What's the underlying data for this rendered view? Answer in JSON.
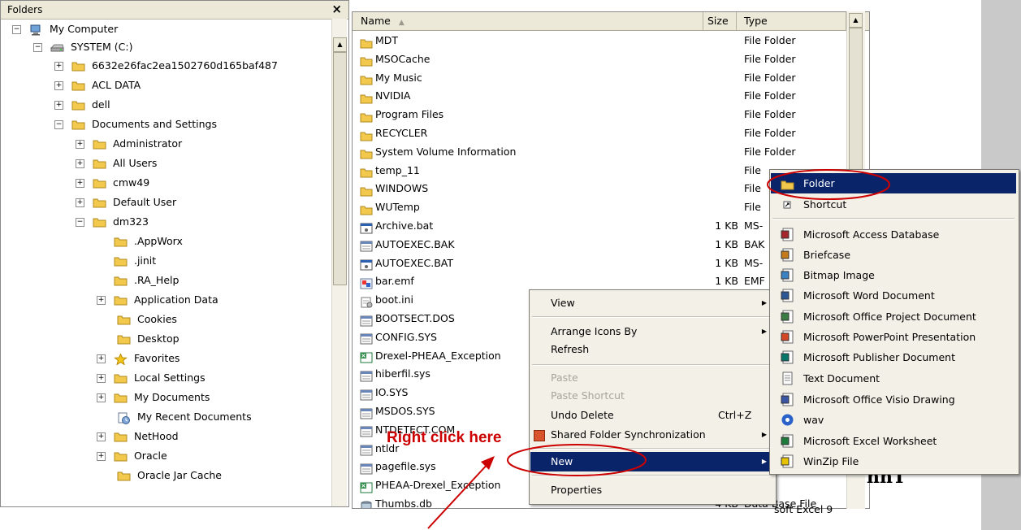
{
  "colors": {
    "accent": "#cc0000",
    "highlight": "#0a246a",
    "folder": "#f2c94c"
  },
  "folders_pane": {
    "title": "Folders",
    "close_label": "×",
    "tree": [
      {
        "label": "My Computer",
        "pm": "minus",
        "icon": "computer-icon"
      },
      {
        "label": "SYSTEM (C:)",
        "pm": "minus",
        "icon": "drive-icon"
      },
      {
        "label": "6632e26fac2ea1502760d165baf487",
        "pm": "plus",
        "icon": "folder-icon"
      },
      {
        "label": "ACL DATA",
        "pm": "plus",
        "icon": "folder-icon"
      },
      {
        "label": "dell",
        "pm": "plus",
        "icon": "folder-icon"
      },
      {
        "label": "Documents and Settings",
        "pm": "minus",
        "icon": "folder-icon"
      },
      {
        "label": "Administrator",
        "pm": "plus",
        "icon": "folder-icon"
      },
      {
        "label": "All Users",
        "pm": "plus",
        "icon": "folder-icon"
      },
      {
        "label": "cmw49",
        "pm": "plus",
        "icon": "folder-icon"
      },
      {
        "label": "Default User",
        "pm": "plus",
        "icon": "folder-icon"
      },
      {
        "label": "dm323",
        "pm": "minus",
        "icon": "folder-icon"
      },
      {
        "label": ".AppWorx",
        "pm": "none",
        "icon": "folder-icon"
      },
      {
        "label": ".jinit",
        "pm": "none",
        "icon": "folder-icon"
      },
      {
        "label": ".RA_Help",
        "pm": "none",
        "icon": "folder-icon"
      },
      {
        "label": "Application Data",
        "pm": "plus",
        "icon": "folder-icon"
      },
      {
        "label": "Cookies",
        "pm": "none",
        "icon": "folder-icon"
      },
      {
        "label": "Desktop",
        "pm": "none",
        "icon": "folder-icon"
      },
      {
        "label": "Favorites",
        "pm": "plus",
        "icon": "star-icon"
      },
      {
        "label": "Local Settings",
        "pm": "plus",
        "icon": "folder-icon"
      },
      {
        "label": "My Documents",
        "pm": "plus",
        "icon": "folder-icon"
      },
      {
        "label": "My Recent Documents",
        "pm": "none",
        "icon": "recent-docs-icon"
      },
      {
        "label": "NetHood",
        "pm": "plus",
        "icon": "folder-icon"
      },
      {
        "label": "Oracle",
        "pm": "plus",
        "icon": "folder-icon"
      },
      {
        "label": "Oracle Jar Cache",
        "pm": "none",
        "icon": "folder-icon"
      }
    ]
  },
  "files_pane": {
    "columns": {
      "name": "Name",
      "size": "Size",
      "type": "Type"
    },
    "rows": [
      {
        "name": "MDT",
        "size": "",
        "type": "File Folder",
        "icon": "folder-icon"
      },
      {
        "name": "MSOCache",
        "size": "",
        "type": "File Folder",
        "icon": "folder-icon"
      },
      {
        "name": "My Music",
        "size": "",
        "type": "File Folder",
        "icon": "folder-icon"
      },
      {
        "name": "NVIDIA",
        "size": "",
        "type": "File Folder",
        "icon": "folder-icon"
      },
      {
        "name": "Program Files",
        "size": "",
        "type": "File Folder",
        "icon": "folder-icon"
      },
      {
        "name": "RECYCLER",
        "size": "",
        "type": "File Folder",
        "icon": "folder-icon"
      },
      {
        "name": "System Volume Information",
        "size": "",
        "type": "File Folder",
        "icon": "folder-icon"
      },
      {
        "name": "temp_11",
        "size": "",
        "type": "File",
        "icon": "folder-icon"
      },
      {
        "name": "WINDOWS",
        "size": "",
        "type": "File",
        "icon": "folder-icon"
      },
      {
        "name": "WUTemp",
        "size": "",
        "type": "File",
        "icon": "folder-icon"
      },
      {
        "name": "Archive.bat",
        "size": "1 KB",
        "type": "MS-",
        "icon": "bat-icon"
      },
      {
        "name": "AUTOEXEC.BAK",
        "size": "1 KB",
        "type": "BAK",
        "icon": "file-icon"
      },
      {
        "name": "AUTOEXEC.BAT",
        "size": "1 KB",
        "type": "MS-",
        "icon": "bat-icon"
      },
      {
        "name": "bar.emf",
        "size": "1 KB",
        "type": "EMF",
        "icon": "image-icon"
      },
      {
        "name": "boot.ini",
        "size": "",
        "type": "",
        "icon": "ini-icon"
      },
      {
        "name": "BOOTSECT.DOS",
        "size": "",
        "type": "",
        "icon": "file-icon"
      },
      {
        "name": "CONFIG.SYS",
        "size": "",
        "type": "",
        "icon": "file-icon"
      },
      {
        "name": "Drexel-PHEAA_Exception",
        "size": "",
        "type": "",
        "icon": "excel-icon"
      },
      {
        "name": "hiberfil.sys",
        "size": "",
        "type": "",
        "icon": "file-icon"
      },
      {
        "name": "IO.SYS",
        "size": "",
        "type": "",
        "icon": "file-icon"
      },
      {
        "name": "MSDOS.SYS",
        "size": "",
        "type": "",
        "icon": "file-icon"
      },
      {
        "name": "NTDETECT.COM",
        "size": "",
        "type": "",
        "icon": "file-icon"
      },
      {
        "name": "ntldr",
        "size": "",
        "type": "",
        "icon": "file-icon"
      },
      {
        "name": "pagefile.sys",
        "size": "",
        "type": "",
        "icon": "file-icon"
      },
      {
        "name": "PHEAA-Drexel_Exception",
        "size": "",
        "type": "",
        "icon": "excel-icon"
      },
      {
        "name": "Thumbs.db",
        "size": "4 KB",
        "type": "Data Base File",
        "icon": "db-icon"
      }
    ]
  },
  "context_menu": {
    "view": "View",
    "arrange": "Arrange Icons By",
    "refresh": "Refresh",
    "paste": "Paste",
    "paste_shortcut": "Paste Shortcut",
    "undo_delete": "Undo Delete",
    "undo_shortcut": "Ctrl+Z",
    "shared_sync": "Shared Folder Synchronization",
    "new": "New",
    "properties": "Properties"
  },
  "sub_menu": {
    "items": [
      {
        "label": "Folder",
        "icon": "folder-icon"
      },
      {
        "label": "Shortcut",
        "icon": "shortcut-icon"
      },
      {
        "label": "Microsoft Access Database",
        "icon": "access-icon"
      },
      {
        "label": "Briefcase",
        "icon": "briefcase-icon"
      },
      {
        "label": "Bitmap Image",
        "icon": "bitmap-icon"
      },
      {
        "label": "Microsoft Word Document",
        "icon": "word-icon"
      },
      {
        "label": "Microsoft Office Project Document",
        "icon": "project-icon"
      },
      {
        "label": "Microsoft PowerPoint Presentation",
        "icon": "powerpoint-icon"
      },
      {
        "label": "Microsoft Publisher Document",
        "icon": "publisher-icon"
      },
      {
        "label": "Text Document",
        "icon": "text-doc-icon"
      },
      {
        "label": "Microsoft Office Visio Drawing",
        "icon": "visio-icon"
      },
      {
        "label": "wav",
        "icon": "wav-icon"
      },
      {
        "label": "Microsoft Excel Worksheet",
        "icon": "excel-icon"
      },
      {
        "label": "WinZip File",
        "icon": "winzip-icon"
      }
    ]
  },
  "annotation": {
    "text": "Right click here"
  },
  "background_fragment": {
    "text": "soft Excel 9",
    "bold_text": "nnT"
  }
}
